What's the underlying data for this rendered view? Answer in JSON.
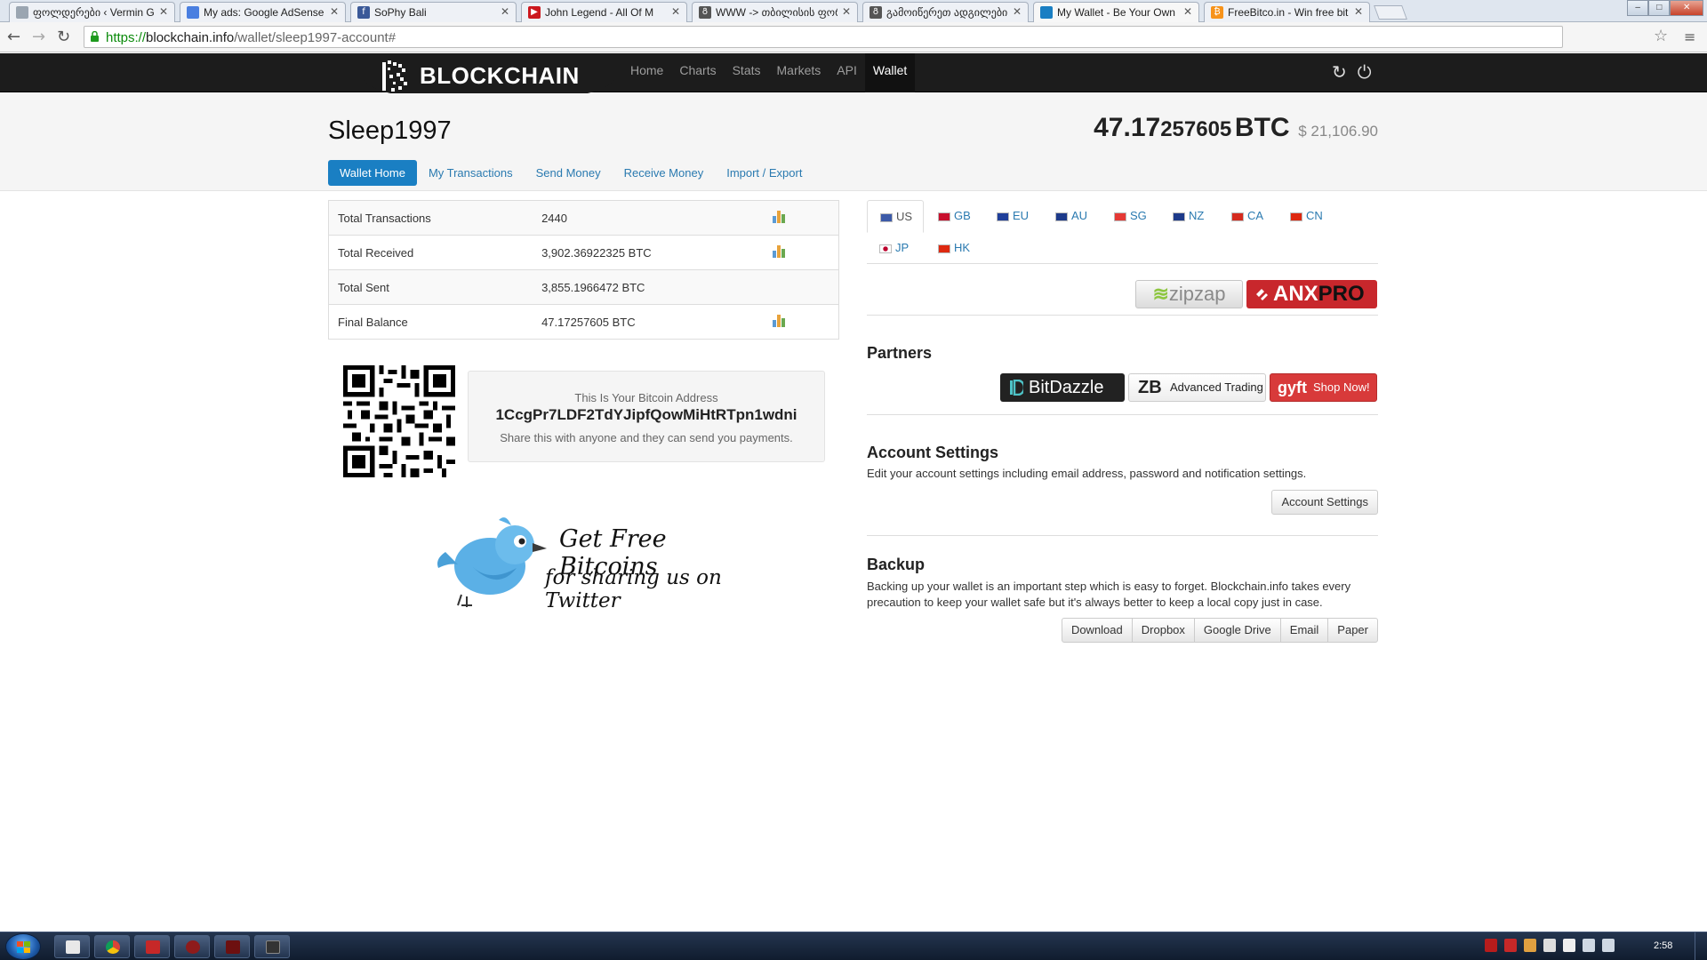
{
  "browser": {
    "tabs": [
      {
        "title": "ფოლდერები ‹ Vermin Gene",
        "favicon_color": "#9aa5b1"
      },
      {
        "title": "My ads: Google AdSense",
        "favicon_color": "#4a7fe0"
      },
      {
        "title": "SoPhy Bali",
        "favicon_color": "#3b5998"
      },
      {
        "title": "John Legend - All Of M",
        "favicon_color": "#cc181e"
      },
      {
        "title": "WWW -> თბილისის ფორ",
        "favicon_color": "#555555"
      },
      {
        "title": "გამოიწერეთ ადგილები B",
        "favicon_color": "#555555"
      },
      {
        "title": "My Wallet - Be Your Own",
        "favicon_color": "#1a7fc3"
      },
      {
        "title": "FreeBitco.in - Win free bit",
        "favicon_color": "#f7931a"
      }
    ],
    "url_proto": "https://",
    "url_host": "blockchain.info",
    "url_path": "/wallet/sleep1997-account#"
  },
  "site": {
    "logo": "BLOCKCHAIN",
    "nav": [
      "Home",
      "Charts",
      "Stats",
      "Markets",
      "API",
      "Wallet"
    ],
    "active_nav": "Wallet"
  },
  "wallet": {
    "name": "Sleep1997",
    "balance_big": "47.17",
    "balance_small": "257605",
    "balance_unit": "BTC",
    "balance_usd": "$ 21,106.90",
    "tabs": [
      "Wallet Home",
      "My Transactions",
      "Send Money",
      "Receive Money",
      "Import / Export"
    ],
    "active_tab": "Wallet Home"
  },
  "stats": [
    {
      "label": "Total Transactions",
      "value": "2440",
      "chart": true
    },
    {
      "label": "Total Received",
      "value": "3,902.36922325 BTC",
      "chart": true
    },
    {
      "label": "Total Sent",
      "value": "3,855.1966472 BTC",
      "chart": false
    },
    {
      "label": "Final Balance",
      "value": "47.17257605 BTC",
      "chart": true
    }
  ],
  "address": {
    "caption": "This Is Your Bitcoin Address",
    "value": "1CcgPr7LDF2TdYJipfQowMiHtRTpn1wdni",
    "note": "Share this with anyone and they can send you payments."
  },
  "promo": {
    "line1": "Get Free Bitcoins",
    "line2": "for sharing us on Twitter"
  },
  "currencies": [
    {
      "code": "US",
      "flag": "#3c5aa8"
    },
    {
      "code": "GB",
      "flag": "#c8102e"
    },
    {
      "code": "EU",
      "flag": "#1f3f9a"
    },
    {
      "code": "AU",
      "flag": "#1d3a8a"
    },
    {
      "code": "SG",
      "flag": "#e53935"
    },
    {
      "code": "NZ",
      "flag": "#1d3a8a"
    },
    {
      "code": "CA",
      "flag": "#d52b1e"
    },
    {
      "code": "CN",
      "flag": "#de2910"
    },
    {
      "code": "JP",
      "flag": "#ffffff"
    },
    {
      "code": "HK",
      "flag": "#de2910"
    }
  ],
  "active_currency": "US",
  "exchanges": {
    "zipzap": "zipzap",
    "anx": "ANX",
    "anx_pro": "PRO"
  },
  "partners": {
    "heading": "Partners",
    "bitdazzle": "BitDazzle",
    "advanced": "Advanced Trading",
    "advanced_mark": "ZB",
    "gyft_mark": "gyft",
    "gyft": "Shop Now!"
  },
  "account": {
    "heading": "Account Settings",
    "desc": "Edit your account settings including email address, password and notification settings.",
    "button": "Account Settings"
  },
  "backup": {
    "heading": "Backup",
    "desc": "Backing up your wallet is an important step which is easy to forget. Blockchain.info takes every precaution to keep your wallet safe but it's always better to keep a local copy just in case.",
    "buttons": [
      "Download",
      "Dropbox",
      "Google Drive",
      "Email",
      "Paper"
    ]
  },
  "taskbar": {
    "clock": "2:58",
    "apps": [
      "explorer",
      "chrome",
      "filezilla",
      "app4",
      "app5",
      "app6"
    ]
  },
  "colors": {
    "brand": "#1a7fc3",
    "header": "#1c1c1c",
    "link": "#2a7ab0"
  }
}
